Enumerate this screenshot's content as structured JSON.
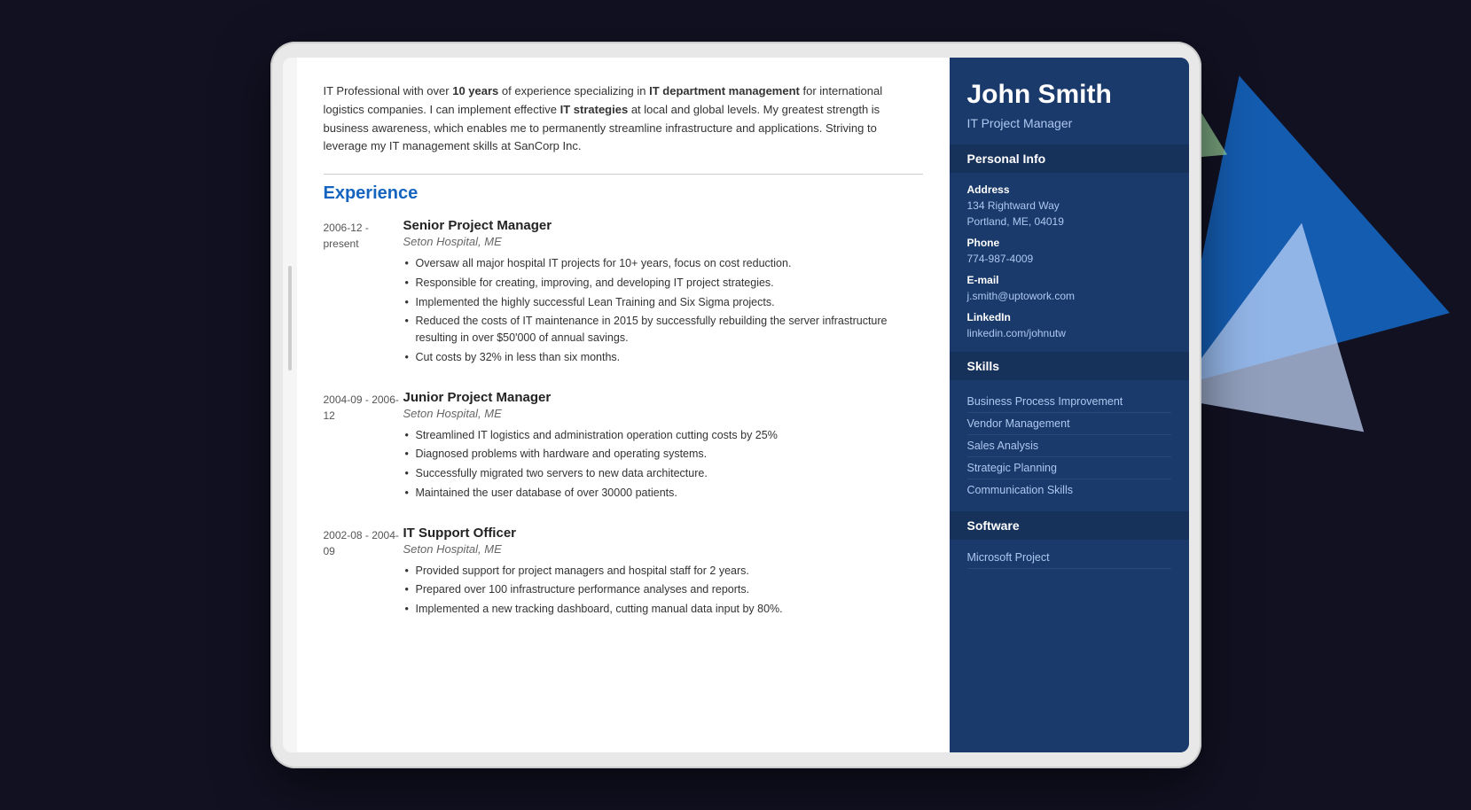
{
  "resume": {
    "sidebar": {
      "name": "John Smith",
      "role": "IT Project Manager",
      "sections": {
        "personal_info_label": "Personal Info",
        "address_label": "Address",
        "address_line1": "134 Rightward Way",
        "address_line2": "Portland, ME, 04019",
        "phone_label": "Phone",
        "phone": "774-987-4009",
        "email_label": "E-mail",
        "email": "j.smith@uptowork.com",
        "linkedin_label": "LinkedIn",
        "linkedin": "linkedin.com/johnutw",
        "skills_label": "Skills",
        "skills": [
          "Business Process Improvement",
          "Vendor Management",
          "Sales Analysis",
          "Strategic Planning",
          "Communication Skills"
        ],
        "software_label": "Software",
        "software": [
          "Microsoft Project"
        ]
      }
    },
    "summary": "IT Professional with over 10 years of experience specializing in IT department management for international logistics companies. I can implement effective IT strategies at local and global levels. My greatest strength is business awareness, which enables me to permanently streamline infrastructure and applications. Striving to leverage my IT management skills at SanCorp Inc.",
    "experience_title": "Experience",
    "experience": [
      {
        "dates": "2006-12 - present",
        "title": "Senior Project Manager",
        "company": "Seton Hospital, ME",
        "bullets": [
          "Oversaw all major hospital IT projects for 10+ years, focus on cost reduction.",
          "Responsible for creating, improving, and developing IT project strategies.",
          "Implemented the highly successful Lean Training and Six Sigma projects.",
          "Reduced the costs of IT maintenance in 2015 by successfully rebuilding the server infrastructure resulting in over $50'000 of annual savings.",
          "Cut costs by 32% in less than six months."
        ]
      },
      {
        "dates": "2004-09 - 2006-12",
        "title": "Junior Project Manager",
        "company": "Seton Hospital, ME",
        "bullets": [
          "Streamlined IT logistics and administration operation cutting costs by 25%",
          "Diagnosed problems with hardware and operating systems.",
          "Successfully migrated two servers to new data architecture.",
          "Maintained the user database of over 30000 patients."
        ]
      },
      {
        "dates": "2002-08 - 2004-09",
        "title": "IT Support Officer",
        "company": "Seton Hospital, ME",
        "bullets": [
          "Provided support for project managers and hospital staff for 2 years.",
          "Prepared over 100 infrastructure performance analyses and reports.",
          "Implemented a new tracking dashboard, cutting manual data input by 80%."
        ]
      }
    ]
  },
  "decorations": {
    "blue_triangle": "large blue triangle",
    "white_triangle": "white/light triangle",
    "green_triangle": "green triangle"
  }
}
